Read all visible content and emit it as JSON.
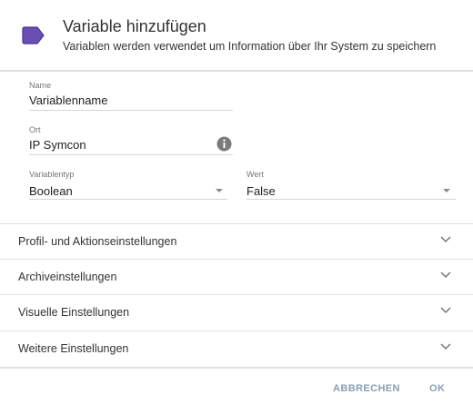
{
  "dialog": {
    "title": "Variable hinzufügen",
    "subtitle": "Variablen werden verwendet um Information über Ihr System zu speichern",
    "icon": "variable-tag-icon",
    "accent_color": "#6a4fb3"
  },
  "fields": {
    "name": {
      "label": "Name",
      "value": "Variablenname"
    },
    "location": {
      "label": "Ort",
      "value": "IP Symcon",
      "icon": "info-icon"
    },
    "variable_type": {
      "label": "Variablentyp",
      "value": "Boolean"
    },
    "value": {
      "label": "Wert",
      "value": "False"
    }
  },
  "sections": [
    {
      "label": "Profil- und Aktionseinstellungen"
    },
    {
      "label": "Archiveinstellungen"
    },
    {
      "label": "Visuelle Einstellungen"
    },
    {
      "label": "Weitere Einstellungen"
    }
  ],
  "actions": {
    "cancel_label": "ABBRECHEN",
    "ok_label": "OK",
    "button_color": "#8aa0b4"
  }
}
